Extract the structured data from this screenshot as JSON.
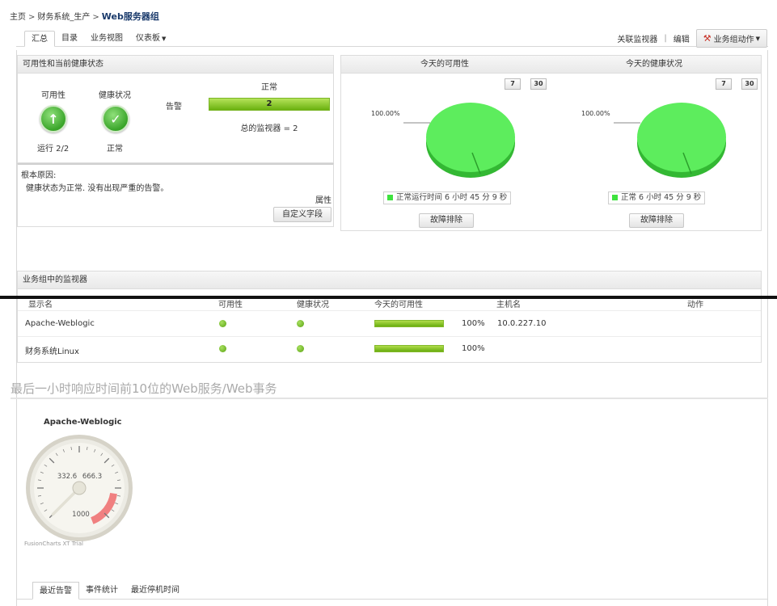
{
  "breadcrumb": {
    "home": "主页",
    "system": "财务系统_生产",
    "current": "Web服务器组",
    "separator": ">"
  },
  "tabs": [
    "汇总",
    "目录",
    "业务视图",
    "仪表板"
  ],
  "toolbar": {
    "associate_monitor": "关联监视器",
    "edit": "编辑",
    "group_actions": "业务组动作"
  },
  "availability_panel": {
    "title": "可用性和当前健康状态",
    "availability_label": "可用性",
    "health_label": "健康状况",
    "availability_status": "运行 2/2",
    "health_status": "正常",
    "alarm_label": "告警",
    "normal_header": "正常",
    "normal_count": "2",
    "total_monitors": "总的监视器 = 2"
  },
  "root_cause": {
    "title": "根本原因:",
    "text": "健康状态为正常. 没有出现严重的告警。",
    "attributes_label": "属性",
    "custom_field_button": "自定义字段"
  },
  "today": {
    "availability_title": "今天的可用性",
    "health_title": "今天的健康状况",
    "btn_7": "7",
    "btn_30": "30",
    "availability_pct_label": "100.00%",
    "health_pct_label": "100.00%",
    "availability_legend": "正常运行时间 6 小时 45 分 9 秒",
    "health_legend": "正常 6 小时 45 分 9 秒",
    "troubleshoot_button": "故障排除",
    "pie_color": "#55e455"
  },
  "monitors": {
    "title": "业务组中的监视器",
    "columns": [
      "显示名",
      "可用性",
      "健康状况",
      "今天的可用性",
      "主机名",
      "动作"
    ],
    "rows": [
      {
        "name": "Apache-Weblogic",
        "availability_pct": "100%",
        "hostname": "10.0.227.10"
      },
      {
        "name": "财务系统Linux",
        "availability_pct": "100%",
        "hostname": ""
      }
    ]
  },
  "top10": {
    "title": "最后一小时响应时间前10位的Web服务/Web事务",
    "gauge_title": "Apache-Weblogic",
    "gauge_ticks": [
      "332.6",
      "666.3",
      "1000"
    ],
    "gauge_value": 0,
    "gauge_max": 1000,
    "watermark": "FusionCharts XT Trial"
  },
  "bottom_tabs": [
    "最近告警",
    "事件统计",
    "最近停机时间"
  ]
}
